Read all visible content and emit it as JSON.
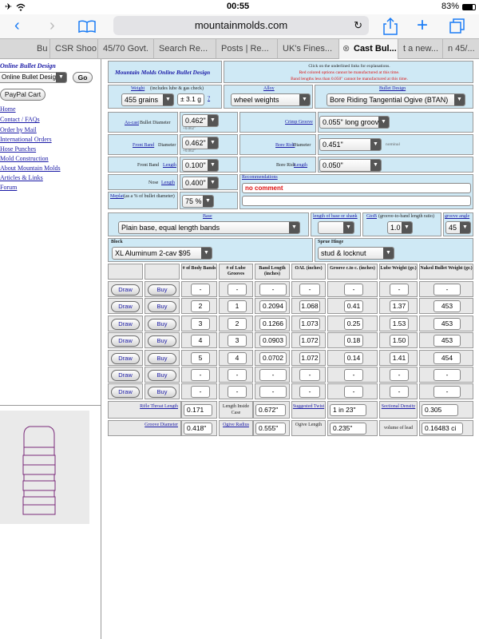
{
  "status": {
    "time": "00:55",
    "battery": "83%"
  },
  "browser": {
    "url": "mountainmolds.com"
  },
  "tabs": [
    "Bu",
    "CSR Shoo",
    "45/70 Govt.",
    "Search Re...",
    "Posts | Re...",
    "UK's Fines...",
    "Cast Bul...",
    "t a new...",
    "n 45/..."
  ],
  "sidebar": {
    "title": "Online Bullet Design",
    "select_value": "Online Bullet Design",
    "go_label": "Go",
    "paypal_label": "PayPal Cart",
    "links": [
      "Home",
      "Contact / FAQs",
      "Order by Mail",
      "International Orders",
      "Hose Punches",
      "Mold Construction",
      "About Mountain Molds",
      "Articles & Links",
      "Forum"
    ]
  },
  "form": {
    "title": "Mountain Molds Online Bullet Design",
    "info": [
      "Click on the underlined links for explanations.",
      "Red colored options cannot be manufactured at this time.",
      "Band lengths less than 0.050\" cannot be manufactured at this time."
    ],
    "weight_label": "Weight",
    "weight_note": "(includes lube & gas check)",
    "weight_value": "455 grains",
    "weight_tol": "± 3.1 g",
    "help": "?",
    "alloy_label": "Alloy",
    "alloy_value": "wheel weights",
    "bullet_design_label": "Bullet Design",
    "bullet_design_value": "Bore Riding Tangential Ogive (BTAN)",
    "ascast_label": "As-cast",
    "ascast_label2": "Bullet Diameter",
    "ascast_value": "0.462\"",
    "ascast_tol": "+0.002\"",
    "crimp_label": "Crimp Groove",
    "crimp_value": "0.055\" long groove",
    "frontband_label": "Front Band",
    "frontband_label2": "Diameter",
    "frontband_value": "0.462\"",
    "frontband_tol": "+0.002\"",
    "boreride_label": "Bore Ride",
    "boreride_label2": "Diameter",
    "boreride_value": "0.451\"",
    "boreride_note": "nominal",
    "fbl_label": "Front Band",
    "fbl_label2": "Length",
    "fbl_value": "0.100\"",
    "brl_label": "Bore Ride",
    "brl_label2": "Length",
    "brl_value": "0.050\"",
    "nose_label": "Nose",
    "nose_label2": "Length",
    "nose_value": "0.400\"",
    "recs_label": "Recommendations",
    "recs_value": "no comment",
    "meplat_label": "Meplat",
    "meplat_note": "(as a % of bullet diameter)",
    "meplat_value": "75 %",
    "base_label": "Base",
    "base_value": "Plain base, equal length bands",
    "lob_label": "length of base or shank",
    "lob_value": "",
    "gtob_label": "GtoB",
    "gtob_note": "(groove-to-band length ratio)",
    "gtob_value": "1.0",
    "groove_angle_label": "groove angle",
    "groove_angle_value": "45",
    "block_label": "Block",
    "block_value": "XL Aluminum 2-cav $95",
    "sprue_label": "Sprue Hinge",
    "sprue_value": "stud & locknut",
    "table_headers": [
      "# of Body Bands",
      "# of Lube Grooves",
      "Band Length (inches)",
      "OAL (inches)",
      "Groove c.to c. (inches)",
      "Lube Weight (gr.)",
      "Naked Bullet Weight (gr.)"
    ],
    "draw_label": "Draw",
    "buy_label": "Buy",
    "rows": [
      [
        "-",
        "-",
        "-",
        "-",
        "-",
        "-",
        "-"
      ],
      [
        "2",
        "1",
        "0.2094",
        "1.068",
        "0.41",
        "1.37",
        "453"
      ],
      [
        "3",
        "2",
        "0.1266",
        "1.073",
        "0.25",
        "1.53",
        "453"
      ],
      [
        "4",
        "3",
        "0.0903",
        "1.072",
        "0.18",
        "1.50",
        "453"
      ],
      [
        "5",
        "4",
        "0.0702",
        "1.072",
        "0.14",
        "1.41",
        "454"
      ],
      [
        "-",
        "-",
        "-",
        "-",
        "-",
        "-",
        "-"
      ],
      [
        "-",
        "-",
        "-",
        "-",
        "-",
        "-",
        "-"
      ]
    ],
    "results": {
      "rifle_throat_label": "Rifle Throat Length",
      "rifle_throat_value": "0.171",
      "length_inside_label": "Length Inside Case",
      "length_inside_value": "0.672\"",
      "suggested_twist_label": "Suggested Twist",
      "suggested_twist_value": "1 in 23\"",
      "sectional_density_label": "Sectional Density",
      "sectional_density_value": "0.305",
      "groove_diameter_label": "Groove Diameter",
      "groove_diameter_value": "0.418\"",
      "ogive_radius_label": "Ogive Radius",
      "ogive_radius_value": "0.555\"",
      "ogive_length_label": "Ogive Length",
      "ogive_length_value": "0.235\"",
      "volume_lead_label": "volume of lead",
      "volume_lead_value": "0.16483 ci"
    }
  }
}
